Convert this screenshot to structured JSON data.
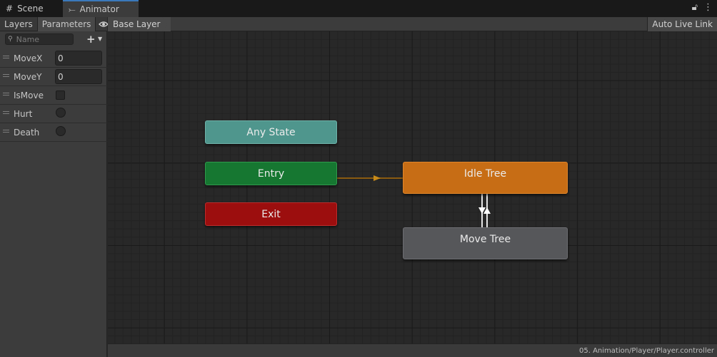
{
  "window": {
    "tabs": [
      {
        "label": "Scene",
        "icon": "grid-icon"
      },
      {
        "label": "Animator",
        "icon": "animator-icon"
      }
    ],
    "right_icons": [
      "lock-icon",
      "more-vertical-icon"
    ]
  },
  "left_panel": {
    "tabs": [
      {
        "label": "Layers"
      },
      {
        "label": "Parameters"
      }
    ],
    "eye_icon": "eye-icon",
    "search": {
      "placeholder": "Name",
      "value": ""
    },
    "add_icon": "plus-icon",
    "parameters": [
      {
        "name": "MoveX",
        "type": "float",
        "value": "0"
      },
      {
        "name": "MoveY",
        "type": "float",
        "value": "0"
      },
      {
        "name": "IsMove",
        "type": "bool",
        "value": false
      },
      {
        "name": "Hurt",
        "type": "trigger"
      },
      {
        "name": "Death",
        "type": "trigger"
      }
    ]
  },
  "graph": {
    "breadcrumb": "Base Layer",
    "live_link_label": "Auto Live Link",
    "nodes": {
      "any_state": "Any State",
      "entry": "Entry",
      "exit": "Exit",
      "idle_tree": "Idle Tree",
      "move_tree": "Move Tree"
    },
    "colors": {
      "any_state": "#4f968d",
      "entry": "#167731",
      "exit": "#9c0e0e",
      "idle_tree": "#c76d15",
      "move_tree": "#56575a",
      "entry_transition": "#8a5a10"
    }
  },
  "status": {
    "path": "05. Animation/Player/Player.controller"
  }
}
